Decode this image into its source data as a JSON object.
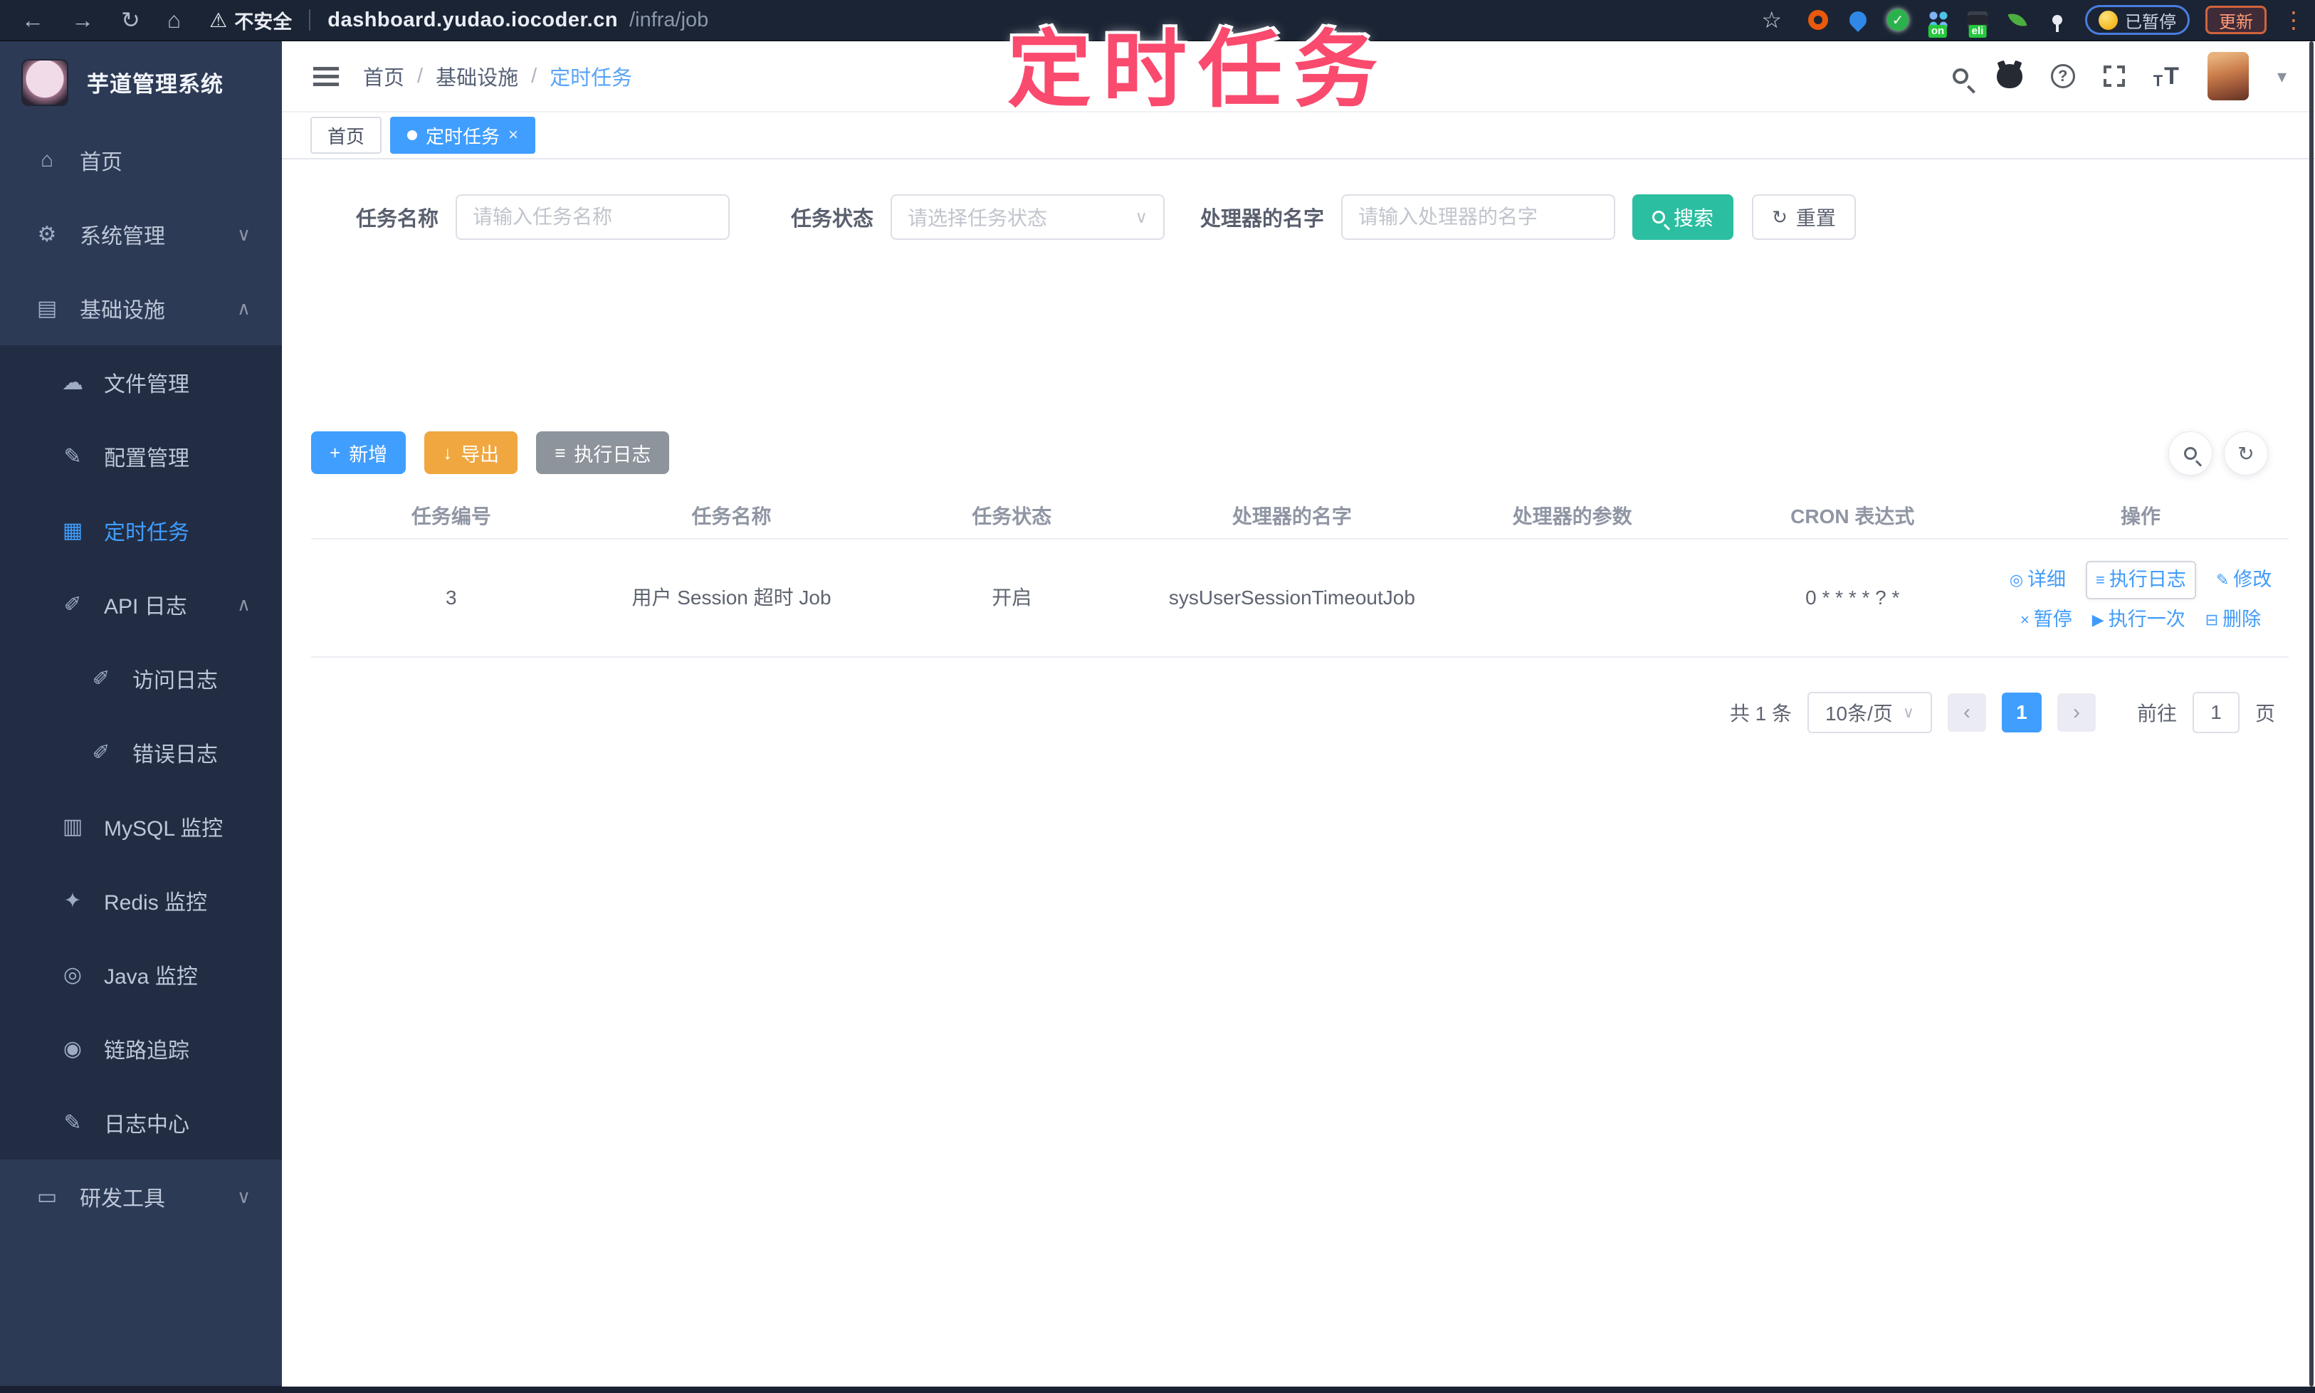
{
  "colors": {
    "accent": "#409EFF",
    "search_teal": "#2CBEA0",
    "export_orange": "#F0A73F",
    "info_gray": "#8E949C",
    "annotation_pink": "#FA4A6E",
    "sidebar_bg": "#2D3A55",
    "submenu_bg": "#222D44",
    "browser_bg": "#1B2434"
  },
  "browser": {
    "security_label": "不安全",
    "url_host": "dashboard.yudao.iocoder.cn",
    "url_path": "/infra/job",
    "paused_label": "已暂停",
    "update_label": "更新",
    "ext_badge_on": "on",
    "ext_badge_eli": "eli"
  },
  "annotation": {
    "text": "定时任务"
  },
  "icons": {
    "back": "←",
    "forward": "→",
    "reload": "↻",
    "nav_home": "⌂",
    "warning": "⚠",
    "star": "☆",
    "check": "✓",
    "kebab": "⋮",
    "home": "⌂",
    "system": "⚙",
    "infra": "▤",
    "file": "☁",
    "config": "✎",
    "job": "▦",
    "api_log": "✐",
    "access_log": "✐",
    "error_log": "✐",
    "mysql": "▥",
    "redis": "✦",
    "java": "◎",
    "trace": "◉",
    "log_center": "✎",
    "tools": "▭",
    "chev_down": "∨",
    "chev_up": "∧",
    "caret": "▾",
    "select_caret": "∨",
    "question": "?",
    "plus": "+",
    "download": "↓",
    "list": "≡",
    "close": "×",
    "detail": "◎",
    "edit": "✎",
    "pause": "×",
    "play": "▶",
    "del": "⊟",
    "refresh": "↻",
    "prev": "‹",
    "next": "›",
    "t_small": "T",
    "t_large": "T"
  },
  "sidebar": {
    "title": "芋道管理系统",
    "items": [
      {
        "label": "首页"
      },
      {
        "label": "系统管理"
      },
      {
        "label": "基础设施"
      },
      {
        "label": "文件管理"
      },
      {
        "label": "配置管理"
      },
      {
        "label": "定时任务"
      },
      {
        "label": "API 日志"
      },
      {
        "label": "访问日志"
      },
      {
        "label": "错误日志"
      },
      {
        "label": "MySQL 监控"
      },
      {
        "label": "Redis 监控"
      },
      {
        "label": "Java 监控"
      },
      {
        "label": "链路追踪"
      },
      {
        "label": "日志中心"
      },
      {
        "label": "研发工具"
      }
    ]
  },
  "header": {
    "breadcrumb": [
      "首页",
      "基础设施",
      "定时任务"
    ],
    "separator": "/"
  },
  "tabbar": {
    "tabs": [
      {
        "label": "首页"
      },
      {
        "label": "定时任务"
      }
    ]
  },
  "filters": {
    "name_label": "任务名称",
    "name_placeholder": "请输入任务名称",
    "status_label": "任务状态",
    "status_placeholder": "请选择任务状态",
    "handler_label": "处理器的名字",
    "handler_placeholder": "请输入处理器的名字",
    "search_label": "搜索",
    "reset_label": "重置"
  },
  "toolbar": {
    "add_label": "新增",
    "export_label": "导出",
    "exec_log_label": "执行日志"
  },
  "table": {
    "headers": [
      "任务编号",
      "任务名称",
      "任务状态",
      "处理器的名字",
      "处理器的参数",
      "CRON 表达式",
      "操作"
    ],
    "rows": [
      {
        "id": "3",
        "name": "用户 Session 超时 Job",
        "status": "开启",
        "handler": "sysUserSessionTimeoutJob",
        "param": "",
        "cron": "0 * * * * ? *"
      }
    ],
    "ops": {
      "detail": "详细",
      "log": "执行日志",
      "edit": "修改",
      "pause": "暂停",
      "run": "执行一次",
      "del": "删除"
    }
  },
  "pagination": {
    "total": "共 1 条",
    "page_size": "10条/页",
    "page": "1",
    "goto": "前往",
    "goto_value": "1",
    "unit": "页"
  }
}
